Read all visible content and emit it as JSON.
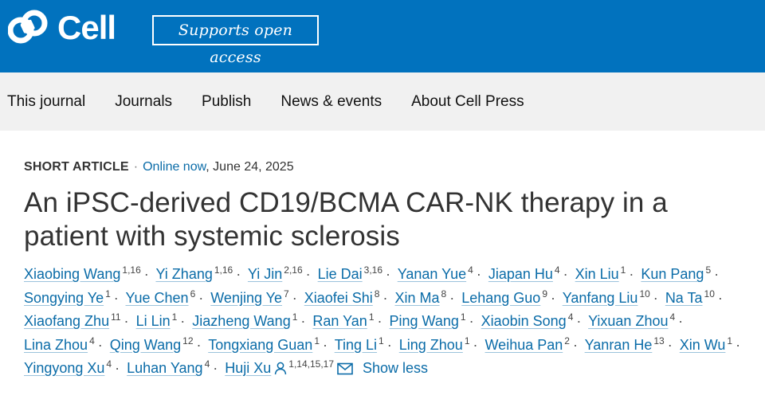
{
  "header": {
    "logo_text": "Cell",
    "badge_text": "Supports open access",
    "brand_color": "#0172be"
  },
  "nav": {
    "items": [
      {
        "label": "This journal"
      },
      {
        "label": "Journals"
      },
      {
        "label": "Publish"
      },
      {
        "label": "News & events"
      },
      {
        "label": "About Cell Press"
      }
    ]
  },
  "article": {
    "type": "SHORT ARTICLE",
    "online": "Online now",
    "date": ", June 24, 2025",
    "title": "An iPSC-derived CD19/BCMA CAR-NK therapy in a patient with systemic sclerosis",
    "show_less": "Show less",
    "authors": [
      {
        "name": "Xiaobing Wang",
        "aff": "1,16"
      },
      {
        "name": "Yi Zhang",
        "aff": "1,16"
      },
      {
        "name": "Yi Jin",
        "aff": "2,16"
      },
      {
        "name": "Lie Dai",
        "aff": "3,16"
      },
      {
        "name": "Yanan Yue",
        "aff": "4"
      },
      {
        "name": "Jiapan Hu",
        "aff": "4"
      },
      {
        "name": "Xin Liu",
        "aff": "1"
      },
      {
        "name": "Kun Pang",
        "aff": "5"
      },
      {
        "name": "Songying Ye",
        "aff": "1"
      },
      {
        "name": "Yue Chen",
        "aff": "6"
      },
      {
        "name": "Wenjing Ye",
        "aff": "7"
      },
      {
        "name": "Xiaofei Shi",
        "aff": "8"
      },
      {
        "name": "Xin Ma",
        "aff": "8"
      },
      {
        "name": "Lehang Guo",
        "aff": "9"
      },
      {
        "name": "Yanfang Liu",
        "aff": "10"
      },
      {
        "name": "Na Ta",
        "aff": "10"
      },
      {
        "name": "Xiaofang Zhu",
        "aff": "11"
      },
      {
        "name": "Li Lin",
        "aff": "1"
      },
      {
        "name": "Jiazheng Wang",
        "aff": "1"
      },
      {
        "name": "Ran Yan",
        "aff": "1"
      },
      {
        "name": "Ping Wang",
        "aff": "1"
      },
      {
        "name": "Xiaobin Song",
        "aff": "4"
      },
      {
        "name": "Yixuan Zhou",
        "aff": "4"
      },
      {
        "name": "Lina Zhou",
        "aff": "4"
      },
      {
        "name": "Qing Wang",
        "aff": "12"
      },
      {
        "name": "Tongxiang Guan",
        "aff": "1"
      },
      {
        "name": "Ting Li",
        "aff": "1"
      },
      {
        "name": "Ling Zhou",
        "aff": "1"
      },
      {
        "name": "Weihua Pan",
        "aff": "2"
      },
      {
        "name": "Yanran He",
        "aff": "13"
      },
      {
        "name": "Xin Wu",
        "aff": "1"
      },
      {
        "name": "Yingyong Xu",
        "aff": "4"
      },
      {
        "name": "Luhan Yang",
        "aff": "4"
      },
      {
        "name": "Huji Xu",
        "aff": "1,14,15,17",
        "corresponding": true
      }
    ]
  },
  "icons": {
    "person": "person-icon",
    "mail": "mail-icon"
  }
}
